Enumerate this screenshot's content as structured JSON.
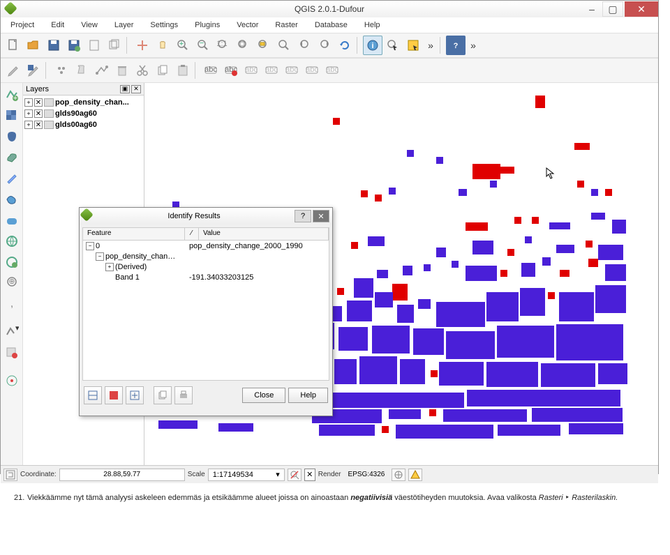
{
  "window": {
    "title": "QGIS 2.0.1-Dufour",
    "minimize": "–",
    "maximize": "▢",
    "close": "✕"
  },
  "menu": [
    "Project",
    "Edit",
    "View",
    "Layer",
    "Settings",
    "Plugins",
    "Vector",
    "Raster",
    "Database",
    "Help"
  ],
  "layers_panel": {
    "title": "Layers",
    "items": [
      {
        "name": "pop_density_chan...",
        "bold": true
      },
      {
        "name": "glds90ag60",
        "bold": true
      },
      {
        "name": "glds00ag60",
        "bold": true
      }
    ]
  },
  "identify": {
    "title": "Identify Results",
    "help_btn": "?",
    "close_btn": "✕",
    "col_feature": "Feature",
    "col_sep": "⁄",
    "col_value": "Value",
    "rows": {
      "root": "0",
      "root_val": "pop_density_change_2000_1990",
      "layer": "pop_density_chan…",
      "derived": "(Derived)",
      "band": "Band 1",
      "band_val": "-191.34033203125"
    },
    "close": "Close",
    "help": "Help"
  },
  "status": {
    "coord_label": "Coordinate:",
    "coord_val": "28.88,59.77",
    "scale_label": "Scale",
    "scale_val": "1:17149534",
    "render": "Render",
    "epsg": "EPSG:4326"
  },
  "overflow": "»",
  "caption": {
    "num": "21.",
    "t1": "Viekkäämme nyt tämä analyysi askeleen edemmäs ja etsikäämme alueet joissa on ainoastaan ",
    "neg": "negatiivisiä",
    "t2": " väestötiheyden muutoksia. Avaa valikosta ",
    "r": "Rasteri",
    "arrow": " ‣ ",
    "t3": "Rasterilaskin."
  }
}
